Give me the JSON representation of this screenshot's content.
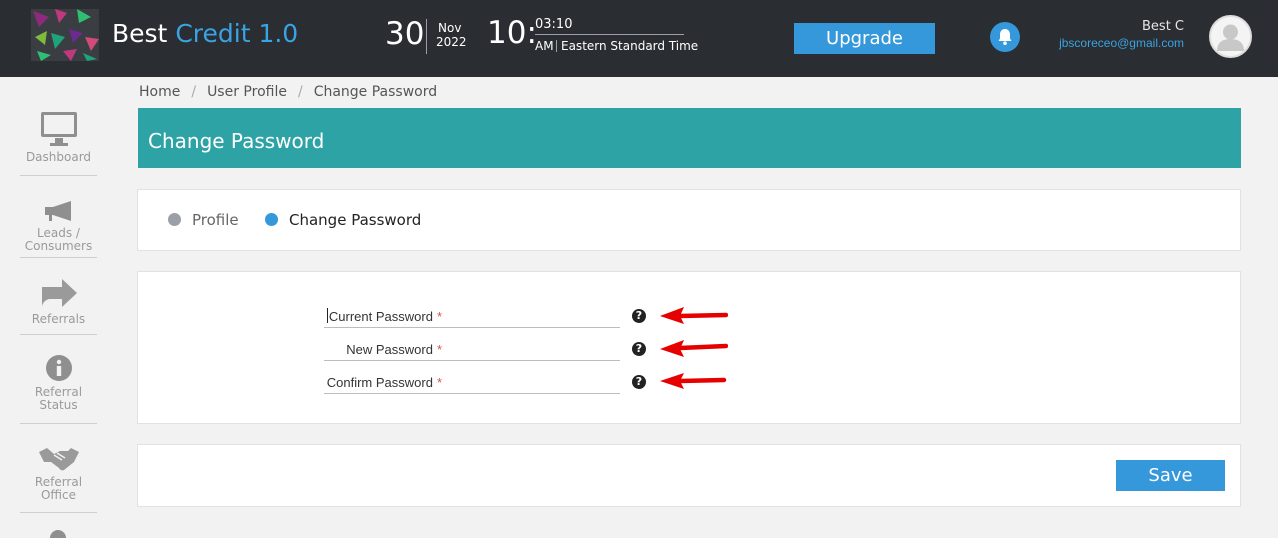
{
  "header": {
    "brand_prefix": "Best",
    "brand_accent": "Credit 1.0",
    "date_day": "30",
    "date_month": "Nov",
    "date_year": "2022",
    "time_hour": "10:",
    "time_minutes": "03:10",
    "time_ampm": "AM",
    "time_zone": "Eastern Standard Time",
    "upgrade_label": "Upgrade",
    "user_name": "Best C",
    "user_email": "jbscoreceo@gmail.com",
    "bell_icon": "bell-icon",
    "avatar_icon": "user-avatar-icon"
  },
  "sidebar": {
    "items": [
      {
        "label": "Dashboard",
        "icon": "monitor-icon"
      },
      {
        "label": "Leads / Consumers",
        "icon": "megaphone-icon"
      },
      {
        "label": "Referrals",
        "icon": "share-arrow-icon"
      },
      {
        "label": "Referral Status",
        "icon": "info-icon"
      },
      {
        "label": "Referral Office",
        "icon": "handshake-icon"
      }
    ]
  },
  "breadcrumb": {
    "items": [
      "Home",
      "User Profile",
      "Change Password"
    ],
    "separator": "/"
  },
  "page": {
    "title": "Change Password"
  },
  "tabs": [
    {
      "label": "Profile",
      "active": false
    },
    {
      "label": "Change Password",
      "active": true
    }
  ],
  "form": {
    "fields": [
      {
        "label": "Current Password",
        "required_mark": "*",
        "value": ""
      },
      {
        "label": "New Password",
        "required_mark": "*",
        "value": ""
      },
      {
        "label": "Confirm Password",
        "required_mark": "*",
        "value": ""
      }
    ],
    "help_glyph": "?"
  },
  "save_label": "Save",
  "colors": {
    "header_bg": "#2a2d31",
    "accent_blue": "#3498db",
    "title_teal": "#2ea3a5",
    "annotation_red": "#e60000",
    "tab_inactive_dot": "#9aa0a6"
  }
}
